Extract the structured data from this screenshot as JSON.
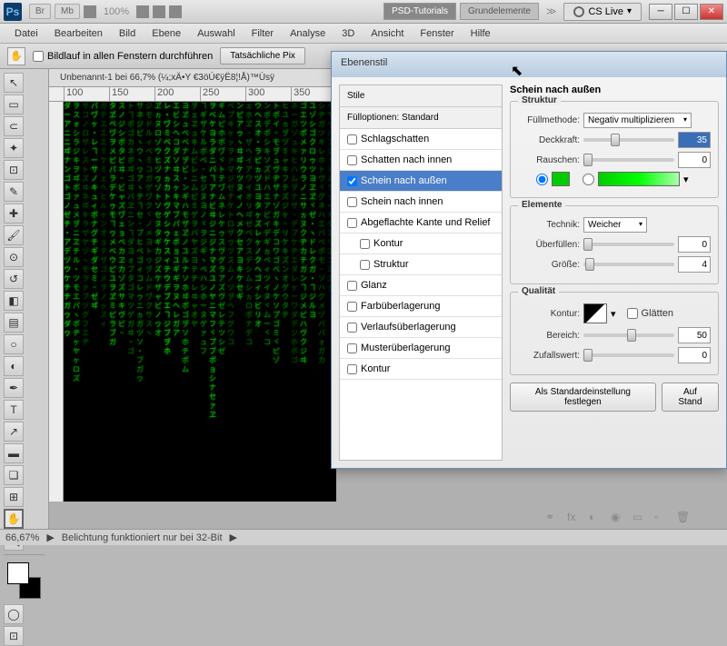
{
  "topbar": {
    "ps": "Ps",
    "br": "Br",
    "mb": "Mb",
    "zoom": "100%",
    "tab1": "PSD-Tutorials",
    "tab2": "Grundelemente",
    "more": "≫",
    "cslive": "CS Live"
  },
  "menu": [
    "Datei",
    "Bearbeiten",
    "Bild",
    "Ebene",
    "Auswahl",
    "Filter",
    "Analyse",
    "3D",
    "Ansicht",
    "Fenster",
    "Hilfe"
  ],
  "optbar": {
    "scroll_all": "Bildlauf in allen Fenstern durchführen",
    "actual_px": "Tatsächliche Pix"
  },
  "doc_title": "Unbenannt-1 bei 66,7% (¼;xÄ•Y €3öÚ€ÿË8¦!Å)™Ùsÿ",
  "ruler": [
    "100",
    "150",
    "200",
    "250",
    "300",
    "350"
  ],
  "status": {
    "zoom": "66,67%",
    "msg": "Belichtung funktioniert nur bei 32-Bit"
  },
  "dialog": {
    "title": "Ebenenstil",
    "section_head": "Schein nach außen",
    "styles_head": "Stile",
    "blend_head": "Füllopt­ionen: Standard",
    "styles": [
      {
        "label": "Schlagschatten",
        "checked": false
      },
      {
        "label": "Schatten nach innen",
        "checked": false
      },
      {
        "label": "Schein nach außen",
        "checked": true,
        "selected": true
      },
      {
        "label": "Schein nach innen",
        "checked": false
      },
      {
        "label": "Abgeflachte Kante und Relief",
        "checked": false
      },
      {
        "label": "Kontur",
        "checked": false,
        "sub": true
      },
      {
        "label": "Struktur",
        "checked": false,
        "sub": true
      },
      {
        "label": "Glanz",
        "checked": false
      },
      {
        "label": "Farbüberlagerung",
        "checked": false
      },
      {
        "label": "Verlaufsüberlagerung",
        "checked": false
      },
      {
        "label": "Musterüberlagerung",
        "checked": false
      },
      {
        "label": "Kontur",
        "checked": false
      }
    ],
    "struktur": {
      "legend": "Struktur",
      "blend_lbl": "Füllmethode:",
      "blend_val": "Negativ multiplizieren",
      "opacity_lbl": "Deckkraft:",
      "opacity_val": "35",
      "noise_lbl": "Rauschen:",
      "noise_val": "0"
    },
    "elemente": {
      "legend": "Elemente",
      "technique_lbl": "Technik:",
      "technique_val": "Weicher",
      "spread_lbl": "Überfüllen:",
      "spread_val": "0",
      "size_lbl": "Größe:",
      "size_val": "4"
    },
    "quality": {
      "legend": "Qualität",
      "contour_lbl": "Kontur:",
      "aa_lbl": "Glätten",
      "range_lbl": "Bereich:",
      "range_val": "50",
      "jitter_lbl": "Zufallswert:",
      "jitter_val": "0"
    },
    "btn_default": "Als Standardeinstellung festlegen",
    "btn_reset": "Auf Stand"
  }
}
